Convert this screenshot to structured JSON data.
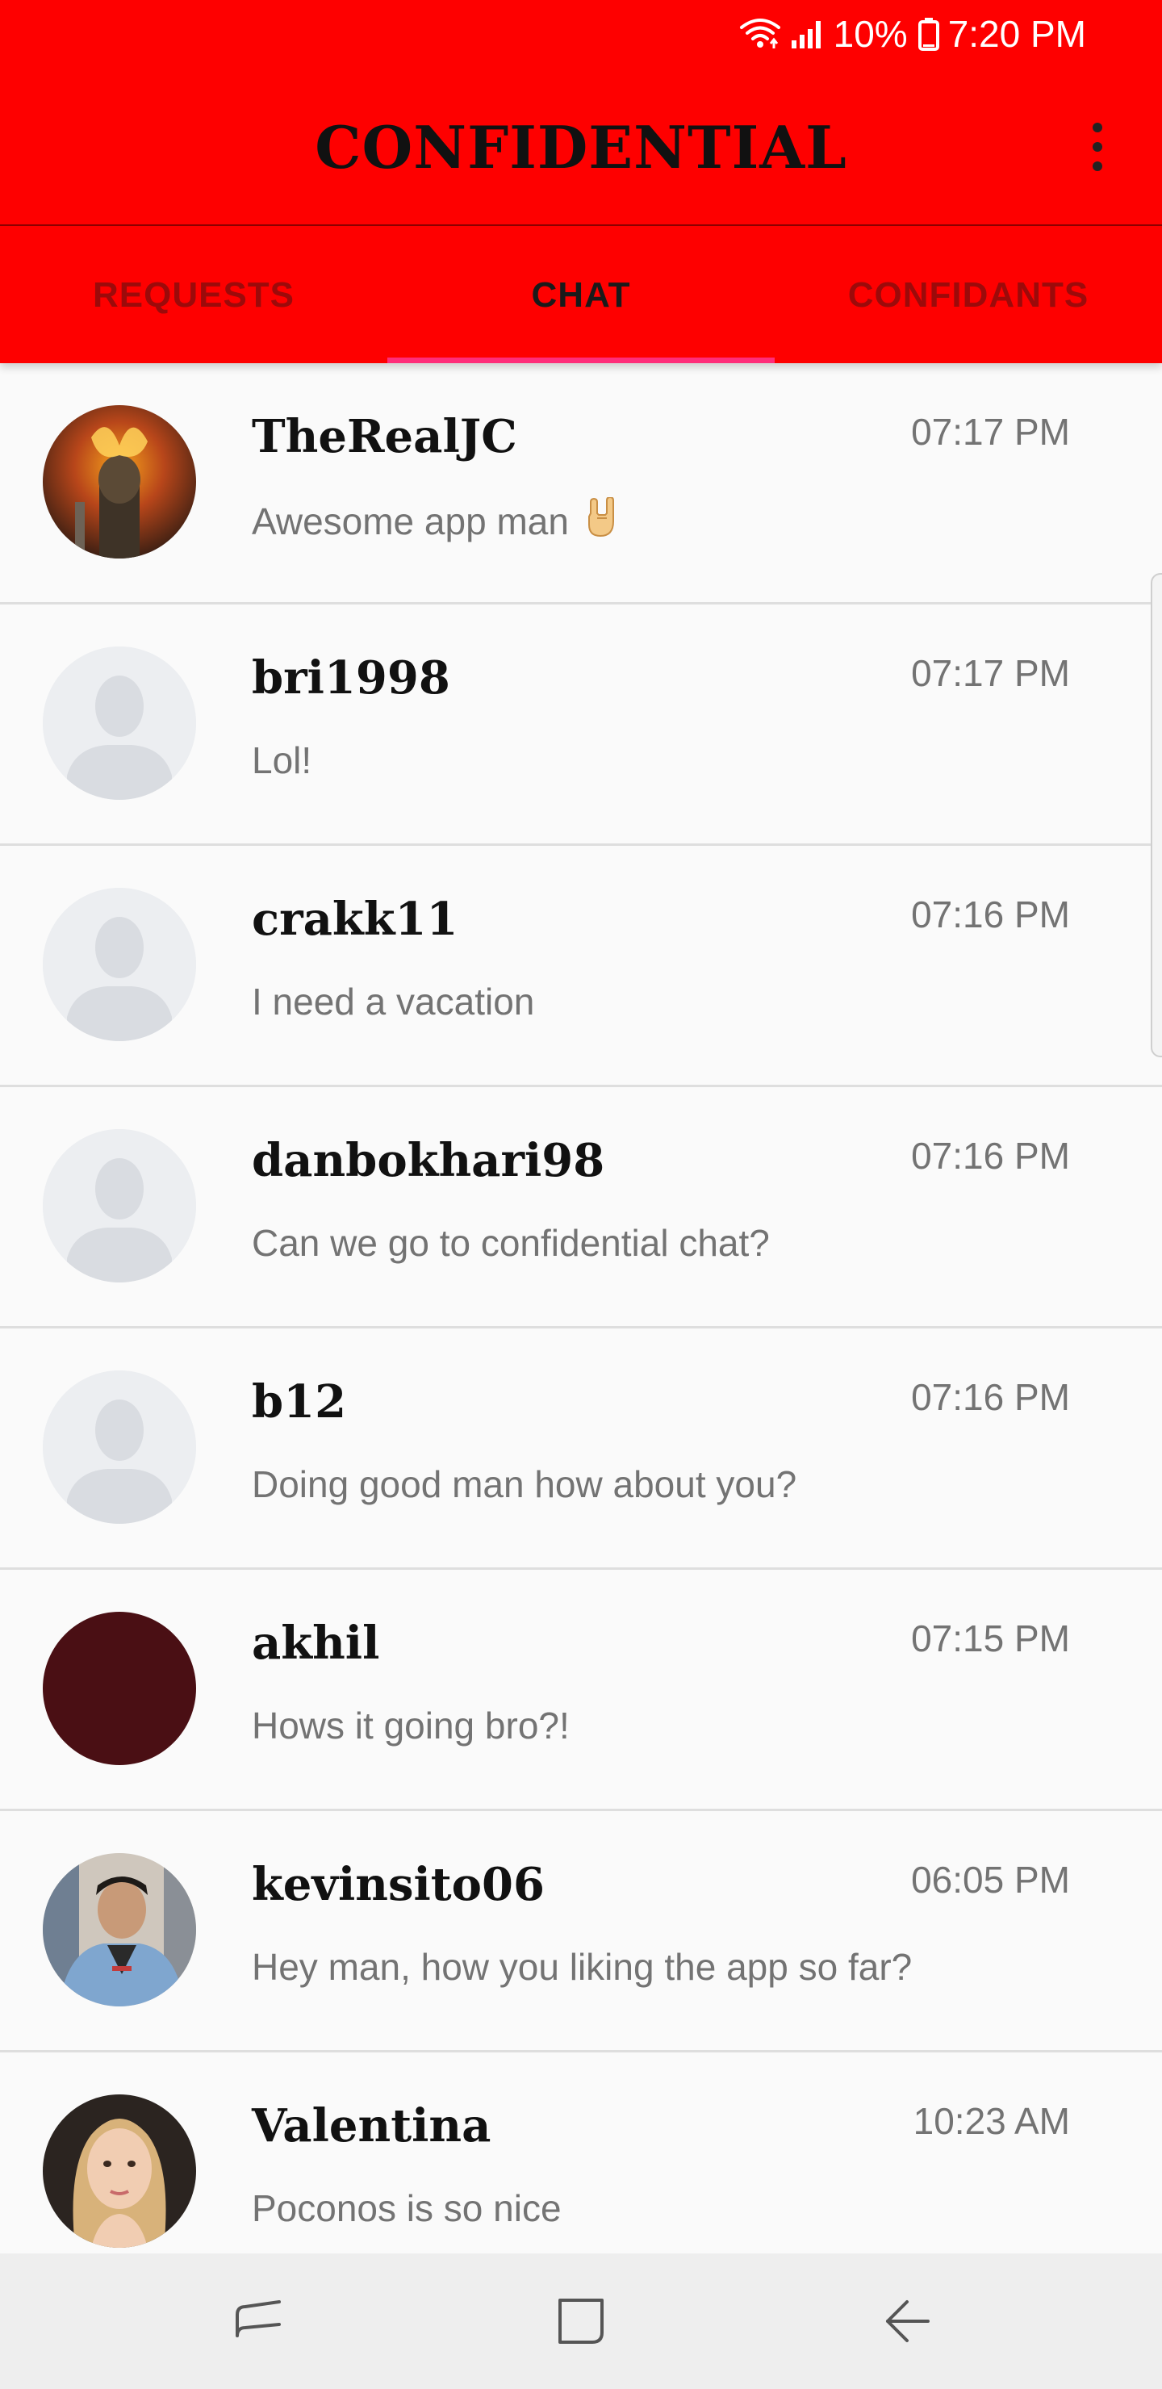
{
  "status_bar": {
    "battery": "10%",
    "time": "7:20 PM",
    "icons": [
      "wifi-icon",
      "signal-icon",
      "battery-icon"
    ]
  },
  "app": {
    "title": "CONFIDENTIAL",
    "menu_icon": "more-vert-icon"
  },
  "tabs": [
    {
      "label": "REQUESTS",
      "active": false
    },
    {
      "label": "CHAT",
      "active": true
    },
    {
      "label": "CONFIDANTS",
      "active": false
    }
  ],
  "chats": [
    {
      "name": "TheRealJC",
      "time": "07:17 PM",
      "message": "Awesome app man",
      "message_emoji": "rock-on-hand-emoji",
      "avatar": "photo"
    },
    {
      "name": "bri1998",
      "time": "07:17 PM",
      "message": "Lol!",
      "avatar": "placeholder"
    },
    {
      "name": "crakk11",
      "time": "07:16 PM",
      "message": "I need a vacation",
      "avatar": "placeholder"
    },
    {
      "name": "danbokhari98",
      "time": "07:16 PM",
      "message": "Can we go to confidential chat?",
      "avatar": "placeholder"
    },
    {
      "name": "b12",
      "time": "07:16 PM",
      "message": "Doing good man how about you?",
      "avatar": "placeholder"
    },
    {
      "name": "akhil",
      "time": "07:15 PM",
      "message": "Hows it going bro?!",
      "avatar": "solid"
    },
    {
      "name": "kevinsito06",
      "time": "06:05 PM",
      "message": "Hey man, how you liking the app so far?",
      "avatar": "photo"
    },
    {
      "name": "Valentina",
      "time": "10:23 AM",
      "message": "Poconos is so nice",
      "avatar": "photo"
    }
  ],
  "colors": {
    "header": "#fe0000",
    "active_tab_indicator": "#ff2d7a",
    "inactive_tab_text": "#9c0a0a",
    "avatar_solid": "#4a0f14"
  },
  "nav_bar": {
    "buttons": [
      "recent-apps-icon",
      "home-icon",
      "back-icon"
    ]
  }
}
